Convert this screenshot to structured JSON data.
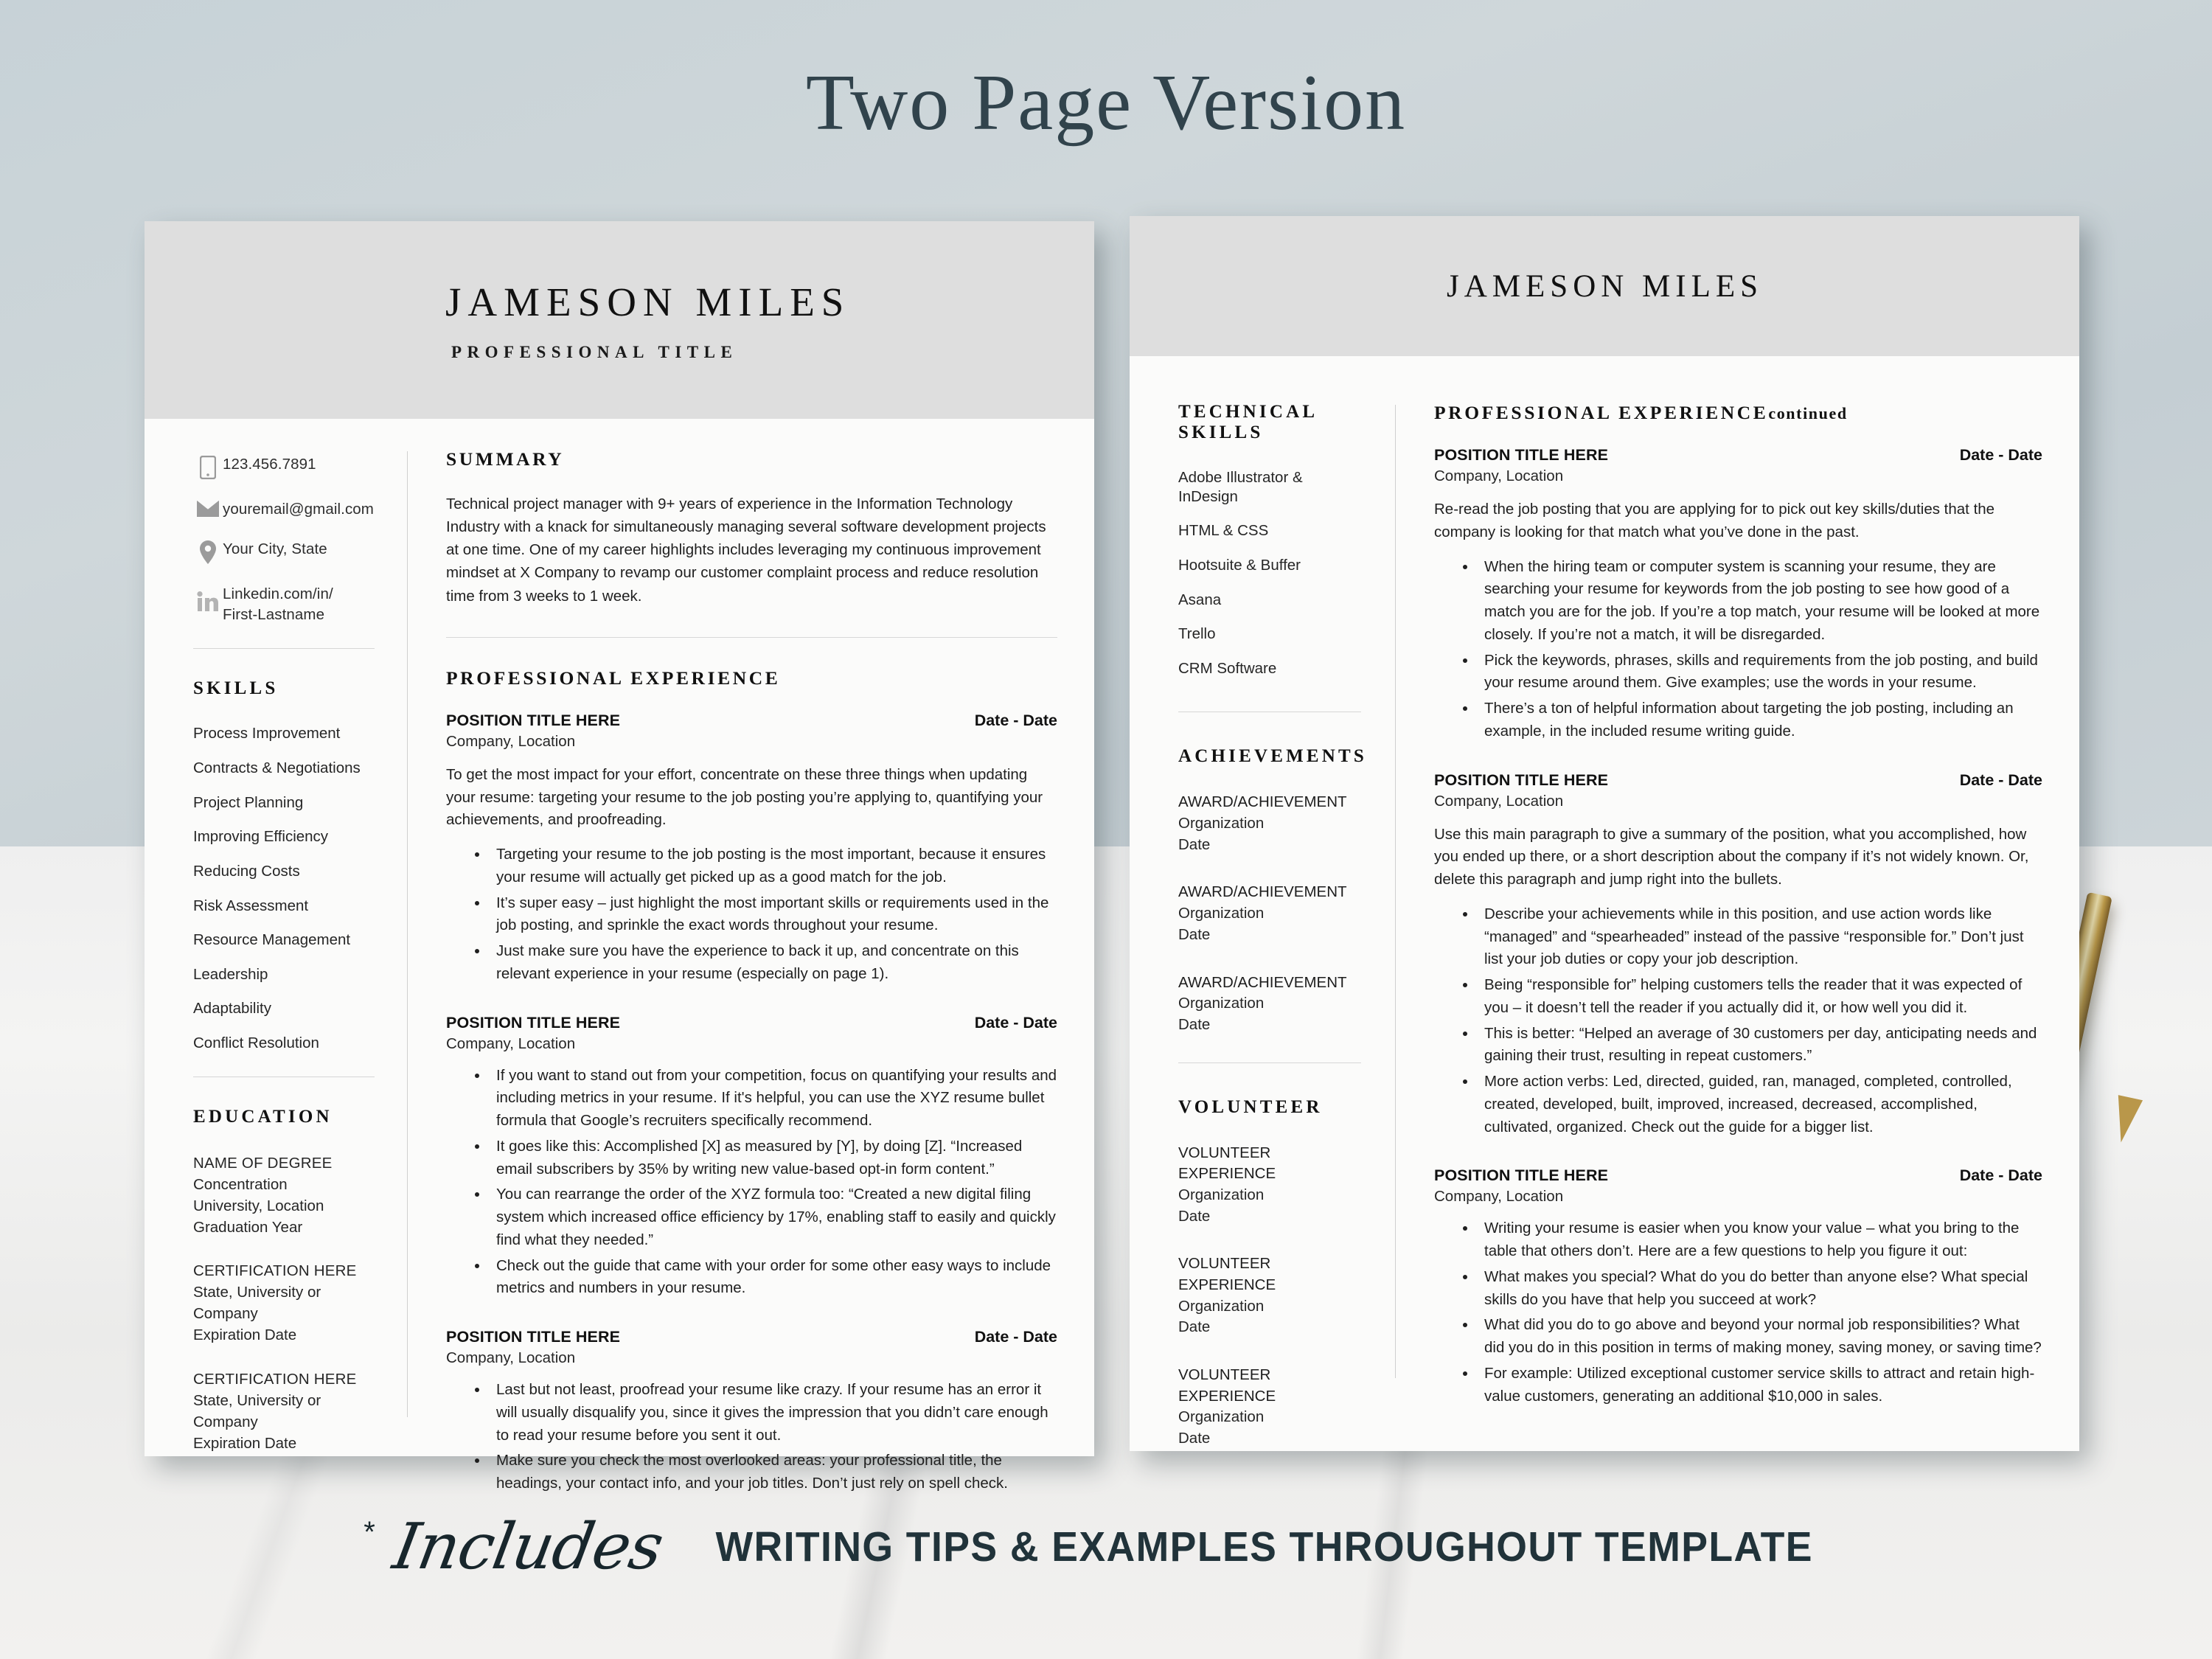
{
  "banner": {
    "title": "Two Page Version"
  },
  "caption": {
    "star": "*",
    "script": "Includes",
    "text": "WRITING TIPS & EXAMPLES THROUGHOUT TEMPLATE"
  },
  "page1": {
    "header": {
      "name": "JAMESON MILES",
      "title": "PROFESSIONAL TITLE"
    },
    "contact": [
      {
        "icon": "phone-icon",
        "text": "123.456.7891"
      },
      {
        "icon": "envelope-icon",
        "text": "youremail@gmail.com"
      },
      {
        "icon": "location-pin-icon",
        "text": "Your City, State"
      },
      {
        "icon": "linkedin-icon",
        "text": "Linkedin.com/in/\nFirst-Lastname"
      }
    ],
    "skills": {
      "heading": "SKILLS",
      "items": [
        "Process Improvement",
        "Contracts & Negotiations",
        "Project Planning",
        "Improving Efficiency",
        "Reducing Costs",
        "Risk Assessment",
        "Resource Management",
        "Leadership",
        "Adaptability",
        "Conflict Resolution"
      ]
    },
    "education": {
      "heading": "EDUCATION",
      "entries": [
        {
          "lines": [
            "NAME OF DEGREE",
            "Concentration",
            "University, Location",
            "Graduation Year"
          ]
        },
        {
          "lines": [
            "CERTIFICATION HERE",
            "State, University or Company",
            "Expiration Date"
          ]
        },
        {
          "lines": [
            "CERTIFICATION HERE",
            "State, University or Company",
            "Expiration Date"
          ]
        }
      ]
    },
    "summary": {
      "heading": "SUMMARY",
      "text": "Technical project manager with 9+ years of experience in the Information Technology Industry with a knack for simultaneously managing several software development projects at one time. One of my career highlights includes leveraging my continuous improvement mindset at X Company to revamp our customer complaint process and reduce resolution time from 3 weeks to 1 week."
    },
    "experience": {
      "heading": "PROFESSIONAL EXPERIENCE",
      "jobs": [
        {
          "title": "POSITION TITLE HERE",
          "date": "Date - Date",
          "company": "Company, Location",
          "paragraph": "To get the most impact for your effort, concentrate on these three things when updating your resume: targeting your resume to the job posting you’re applying to, quantifying your achievements, and proofreading.",
          "bullets": [
            "Targeting your resume to the job posting is the most important, because it ensures your resume will actually get picked up as a good match for the job.",
            "It’s super easy – just highlight the most important skills or requirements used in the job posting, and sprinkle the exact words throughout your resume.",
            "Just make sure you have the experience to back it up, and concentrate on this relevant experience in your resume (especially on page 1)."
          ]
        },
        {
          "title": "POSITION TITLE HERE",
          "date": "Date - Date",
          "company": "Company, Location",
          "paragraph": "",
          "bullets": [
            "If you want to stand out from your competition, focus on quantifying your results and including metrics in your resume. If it's helpful, you can use the XYZ resume bullet formula that Google’s recruiters specifically recommend.",
            "It goes like this: Accomplished [X] as measured by [Y], by doing [Z]. “Increased email subscribers by 35% by writing new value-based opt-in form content.”",
            "You can rearrange the order of the XYZ formula too: “Created a new digital filing system which increased office efficiency by 17%, enabling staff to easily and quickly find what they needed.”",
            "Check out the guide that came with your order for some other easy ways to include metrics and numbers in your resume."
          ]
        },
        {
          "title": "POSITION TITLE HERE",
          "date": "Date - Date",
          "company": "Company, Location",
          "paragraph": "",
          "bullets": [
            "Last but not least, proofread your resume like crazy. If your resume has an error it will usually disqualify you, since it gives the impression that you didn’t care enough to read your resume before you sent it out.",
            "Make sure you check the most overlooked areas: your professional title, the headings, your contact info, and your job titles. Don’t just rely on spell check."
          ]
        }
      ]
    }
  },
  "page2": {
    "header": {
      "name": "JAMESON MILES"
    },
    "technical_skills": {
      "heading": "TECHNICAL SKILLS",
      "items": [
        "Adobe Illustrator & InDesign",
        "HTML & CSS",
        "Hootsuite & Buffer",
        "Asana",
        "Trello",
        "CRM Software"
      ]
    },
    "achievements": {
      "heading": "ACHIEVEMENTS",
      "entries": [
        {
          "title": "AWARD/ACHIEVEMENT",
          "org": "Organization",
          "date": "Date"
        },
        {
          "title": "AWARD/ACHIEVEMENT",
          "org": "Organization",
          "date": "Date"
        },
        {
          "title": "AWARD/ACHIEVEMENT",
          "org": "Organization",
          "date": "Date"
        }
      ]
    },
    "volunteer": {
      "heading": "VOLUNTEER",
      "entries": [
        {
          "title": "VOLUNTEER EXPERIENCE",
          "org": "Organization",
          "date": "Date"
        },
        {
          "title": "VOLUNTEER EXPERIENCE",
          "org": "Organization",
          "date": "Date"
        },
        {
          "title": "VOLUNTEER EXPERIENCE",
          "org": "Organization",
          "date": "Date"
        }
      ]
    },
    "experience": {
      "heading": "PROFESSIONAL EXPERIENCE",
      "heading_suffix": "continued",
      "jobs": [
        {
          "title": "POSITION TITLE HERE",
          "date": "Date - Date",
          "company": "Company, Location",
          "paragraph": "Re-read the job posting that you are applying for to pick out key skills/duties that the company is looking for that match what you’ve done in the past.",
          "bullets": [
            "When the hiring team or computer system is scanning your resume, they are searching your resume for keywords from the job posting to see how good of a match you are for the job. If you’re a top match, your resume will be looked at more closely. If you’re not a match, it will be disregarded.",
            "Pick the keywords, phrases, skills and requirements from the job posting, and build your resume around them. Give examples; use the words in your resume.",
            "There’s a ton of helpful information about targeting the job posting, including an example, in the included resume writing guide."
          ]
        },
        {
          "title": "POSITION TITLE HERE",
          "date": "Date - Date",
          "company": "Company, Location",
          "paragraph": "Use this main paragraph to give a summary of the position, what you accomplished, how you ended up there, or a short description about the company if it’s not widely known. Or, delete this paragraph and jump right into the bullets.",
          "bullets": [
            "Describe your achievements while in this position, and use action words like “managed” and “spearheaded” instead of the passive “responsible for.”  Don’t just list your job duties or copy your job description.",
            "Being “responsible for” helping customers tells the reader that it was expected of you – it doesn’t tell the reader if you actually did it, or how well you did it.",
            "This is better: “Helped an average of 30 customers per day, anticipating needs and gaining their trust, resulting in repeat customers.”",
            "More action verbs: Led, directed, guided, ran, managed, completed, controlled, created, developed, built, improved, increased, decreased, accomplished, cultivated, organized. Check out the guide for a bigger list."
          ]
        },
        {
          "title": "POSITION TITLE HERE",
          "date": "Date - Date",
          "company": "Company, Location",
          "paragraph": "",
          "bullets": [
            "Writing your resume is easier when you know your value – what you bring to the table that others don’t. Here are a few questions to help you figure it out:",
            "What makes you special? What do you do better than anyone else? What special skills do you have that help you succeed at work?",
            "What did you do to go above and beyond your normal job responsibilities? What did you do in this position in terms of making money, saving money, or saving time?",
            "For example:  Utilized exceptional customer service skills to attract and retain high-value customers, generating an additional $10,000 in sales."
          ]
        }
      ]
    }
  },
  "colors": {
    "background_top": "#c9d3d8",
    "background_bottom": "#f0efee",
    "paper": "#fbfbfa",
    "header_band": "#dedede",
    "title_text": "#31434c",
    "icon_grey": "#9b9b9b"
  }
}
